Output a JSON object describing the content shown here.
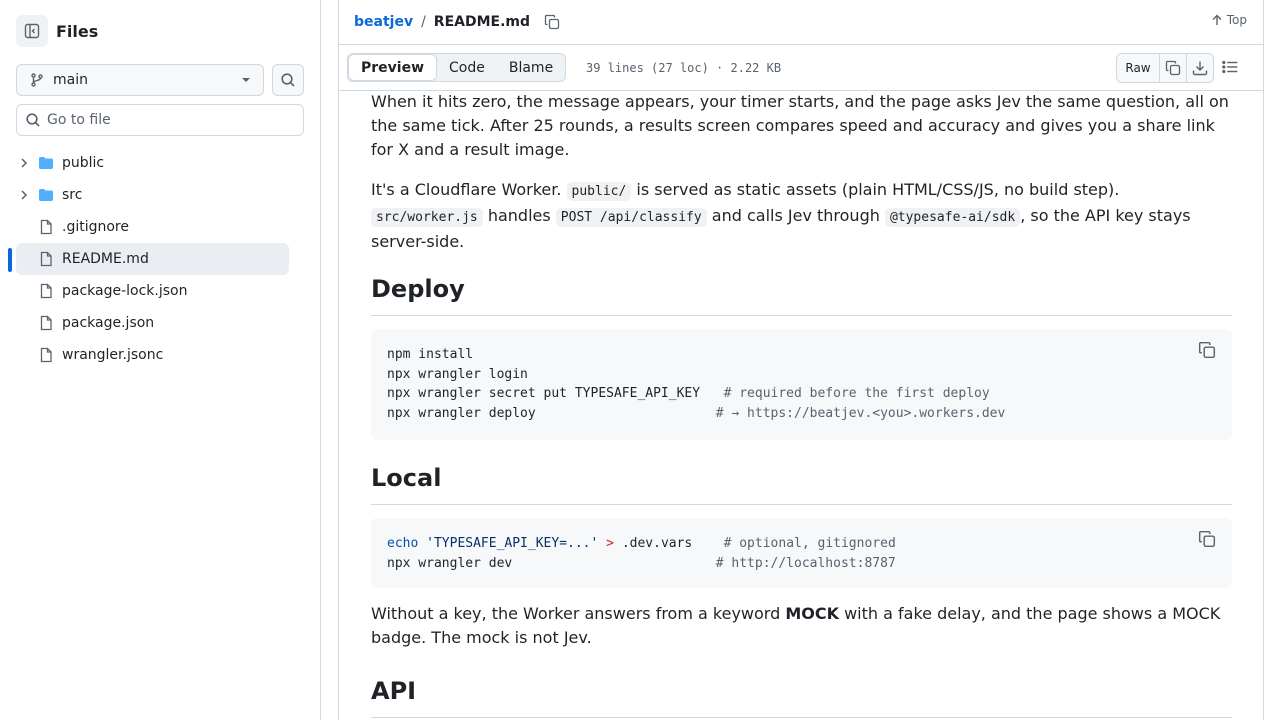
{
  "sidebar": {
    "title": "Files",
    "branch": "main",
    "goto_placeholder": "Go to file",
    "items": [
      {
        "name": "public",
        "type": "folder"
      },
      {
        "name": "src",
        "type": "folder"
      },
      {
        "name": ".gitignore",
        "type": "file"
      },
      {
        "name": "README.md",
        "type": "file",
        "active": true
      },
      {
        "name": "package-lock.json",
        "type": "file"
      },
      {
        "name": "package.json",
        "type": "file"
      },
      {
        "name": "wrangler.jsonc",
        "type": "file"
      }
    ]
  },
  "header": {
    "repo": "beatjev",
    "separator": "/",
    "file": "README.md",
    "top_label": "Top"
  },
  "toolbar": {
    "tabs": [
      "Preview",
      "Code",
      "Blame"
    ],
    "active_tab": "Preview",
    "meta": "39 lines (27 loc) · 2.22 KB",
    "raw_label": "Raw"
  },
  "content": {
    "p1": "When it hits zero, the message appears, your timer starts, and the page asks Jev the same question, all on the same tick. After 25 rounds, a results screen compares speed and accuracy and gives you a share link for X and a result image.",
    "p2": {
      "t1": "It's a Cloudflare Worker. ",
      "c1": "public/",
      "t2": " is served as static assets (plain HTML/CSS/JS, no build step). ",
      "c2": "src/worker.js",
      "t3": " handles ",
      "c3": "POST /api/classify",
      "t4": " and calls Jev through ",
      "c4": "@typesafe-ai/sdk",
      "t5": ", so the API key stays server-side."
    },
    "h_deploy": "Deploy",
    "deploy_code": [
      {
        "cmd": "npm install",
        "comment": ""
      },
      {
        "cmd": "npx wrangler login",
        "comment": ""
      },
      {
        "cmd": "npx wrangler secret put TYPESAFE_API_KEY",
        "comment": "# required before the first deploy"
      },
      {
        "cmd": "npx wrangler deploy",
        "comment": "# → https://beatjev.<you>.workers.dev"
      }
    ],
    "h_local": "Local",
    "local_code": {
      "l1_kw": "echo",
      "l1_str": "'TYPESAFE_API_KEY=...'",
      "l1_op": ">",
      "l1_rest": ".dev.vars",
      "l1_comment": "# optional, gitignored",
      "l2_cmd": "npx wrangler dev",
      "l2_comment": "# http://localhost:8787"
    },
    "p3": {
      "t1": "Without a key, the Worker answers from a keyword ",
      "b1": "MOCK",
      "t2": " with a fake delay, and the page shows a MOCK badge. The mock is not Jev."
    },
    "h_api": "API"
  }
}
